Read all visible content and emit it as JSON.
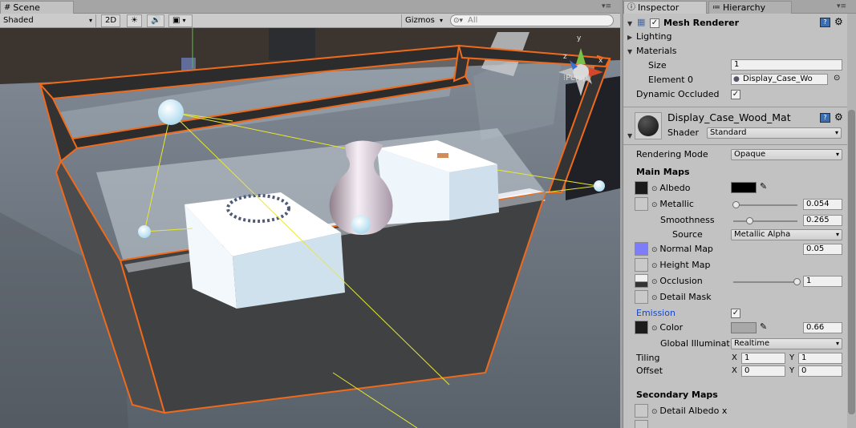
{
  "scene": {
    "tab_label": "Scene",
    "shading_mode": "Shaded",
    "btn_2d": "2D",
    "gizmos_label": "Gizmos",
    "search_placeholder": "All",
    "persp_label": "Persp",
    "gizmo_axes": {
      "y": "y",
      "z": "z",
      "x": "x"
    }
  },
  "inspector": {
    "tab_inspector": "Inspector",
    "tab_hierarchy": "Hierarchy",
    "component_title": "Mesh Renderer",
    "component_enabled": true,
    "lighting_label": "Lighting",
    "materials_label": "Materials",
    "size_label": "Size",
    "size_value": "1",
    "element0_label": "Element 0",
    "element0_value": "Display_Case_Wo",
    "dynamic_occluded_label": "Dynamic Occluded",
    "dynamic_occluded": true,
    "material_name": "Display_Case_Wood_Mat",
    "shader_label": "Shader",
    "shader_value": "Standard",
    "rendering_mode_label": "Rendering Mode",
    "rendering_mode_value": "Opaque",
    "main_maps_label": "Main Maps",
    "albedo_label": "Albedo",
    "metallic_label": "Metallic",
    "metallic_value": "0.054",
    "metallic_fraction": 0.054,
    "smoothness_label": "Smoothness",
    "smoothness_value": "0.265",
    "smoothness_fraction": 0.265,
    "source_label": "Source",
    "source_value": "Metallic Alpha",
    "normal_map_label": "Normal Map",
    "normal_map_value": "0.05",
    "height_map_label": "Height Map",
    "occlusion_label": "Occlusion",
    "occlusion_value": "1",
    "occlusion_fraction": 1.0,
    "detail_mask_label": "Detail Mask",
    "emission_label": "Emission",
    "emission_enabled": true,
    "color_label": "Color",
    "color_value": "0.66",
    "gi_label": "Global Illuminat",
    "gi_value": "Realtime",
    "tiling_label": "Tiling",
    "offset_label": "Offset",
    "tiling_x": "1",
    "tiling_y": "1",
    "offset_x": "0",
    "offset_y": "0",
    "axis_x": "X",
    "axis_y": "Y",
    "secondary_maps_label": "Secondary Maps",
    "detail_albedo_label": "Detail Albedo x"
  },
  "colors": {
    "albedo": "#000000",
    "emission": "#a8a8a8",
    "normal_map": "#7d7dfa",
    "emission_label": "#1646c8",
    "selection_outline": "#f06a1c",
    "light_gizmo": "#e8e830"
  }
}
